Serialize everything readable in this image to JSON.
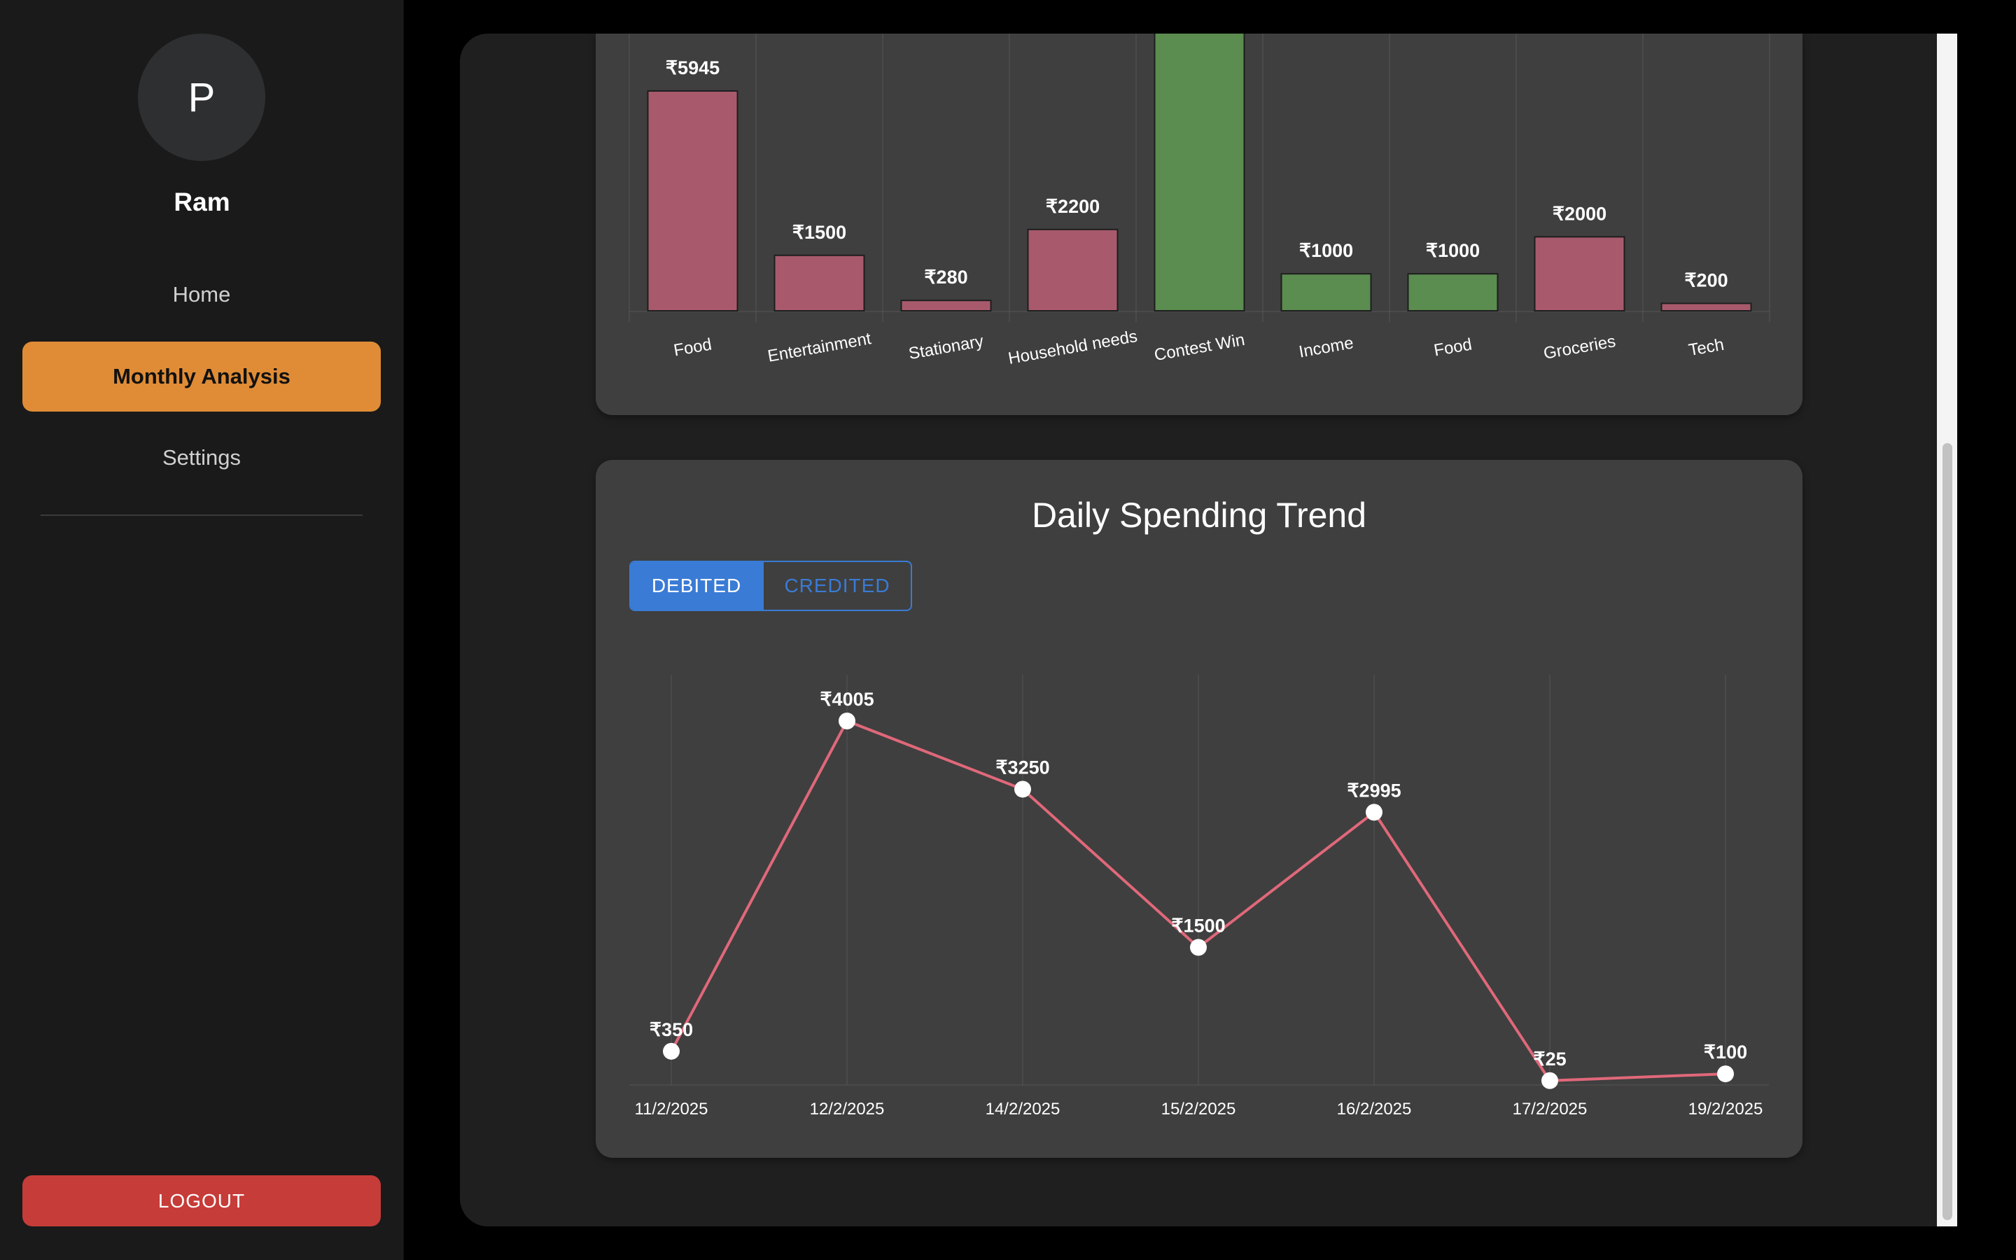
{
  "sidebar": {
    "avatar_letter": "P",
    "username": "Ram",
    "nav": {
      "home": "Home",
      "monthly": "Monthly Analysis",
      "settings": "Settings"
    },
    "logout": "LOGOUT"
  },
  "colors": {
    "accent": "#e08c36",
    "debit_bar": "#a85a6c",
    "credit_bar": "#5b8c50",
    "line": "#e0687a",
    "toggle": "#3a7bd5",
    "logout": "#c63c38"
  },
  "category_chart": {
    "chart_data": {
      "type": "bar",
      "categories": [
        "Food",
        "Entertainment",
        "Stationary",
        "Household needs",
        "Contest Win",
        "Income",
        "Food",
        "Groceries",
        "Tech"
      ],
      "values": [
        5945,
        1500,
        280,
        2200,
        null,
        1000,
        1000,
        2000,
        200
      ],
      "labels": [
        "₹5945",
        "₹1500",
        "₹280",
        "₹2200",
        "",
        "₹1000",
        "₹1000",
        "₹2000",
        "₹200"
      ],
      "kinds": [
        "debit",
        "debit",
        "debit",
        "debit",
        "credit",
        "credit",
        "credit",
        "debit",
        "debit"
      ],
      "ylim": [
        0,
        5945
      ],
      "grid": true
    }
  },
  "trend": {
    "title": "Daily Spending Trend",
    "toggle_debited": "DEBITED",
    "toggle_credited": "CREDITED",
    "chart_data": {
      "type": "line",
      "x": [
        "11/2/2025",
        "12/2/2025",
        "14/2/2025",
        "15/2/2025",
        "16/2/2025",
        "17/2/2025",
        "19/2/2025"
      ],
      "series": [
        {
          "values": [
            350,
            4005,
            3250,
            1500,
            2995,
            25,
            100
          ]
        }
      ],
      "labels": [
        "₹350",
        "₹4005",
        "₹3250",
        "₹1500",
        "₹2995",
        "₹25",
        "₹100"
      ],
      "ylim": [
        0,
        4500
      ],
      "grid": true
    }
  }
}
